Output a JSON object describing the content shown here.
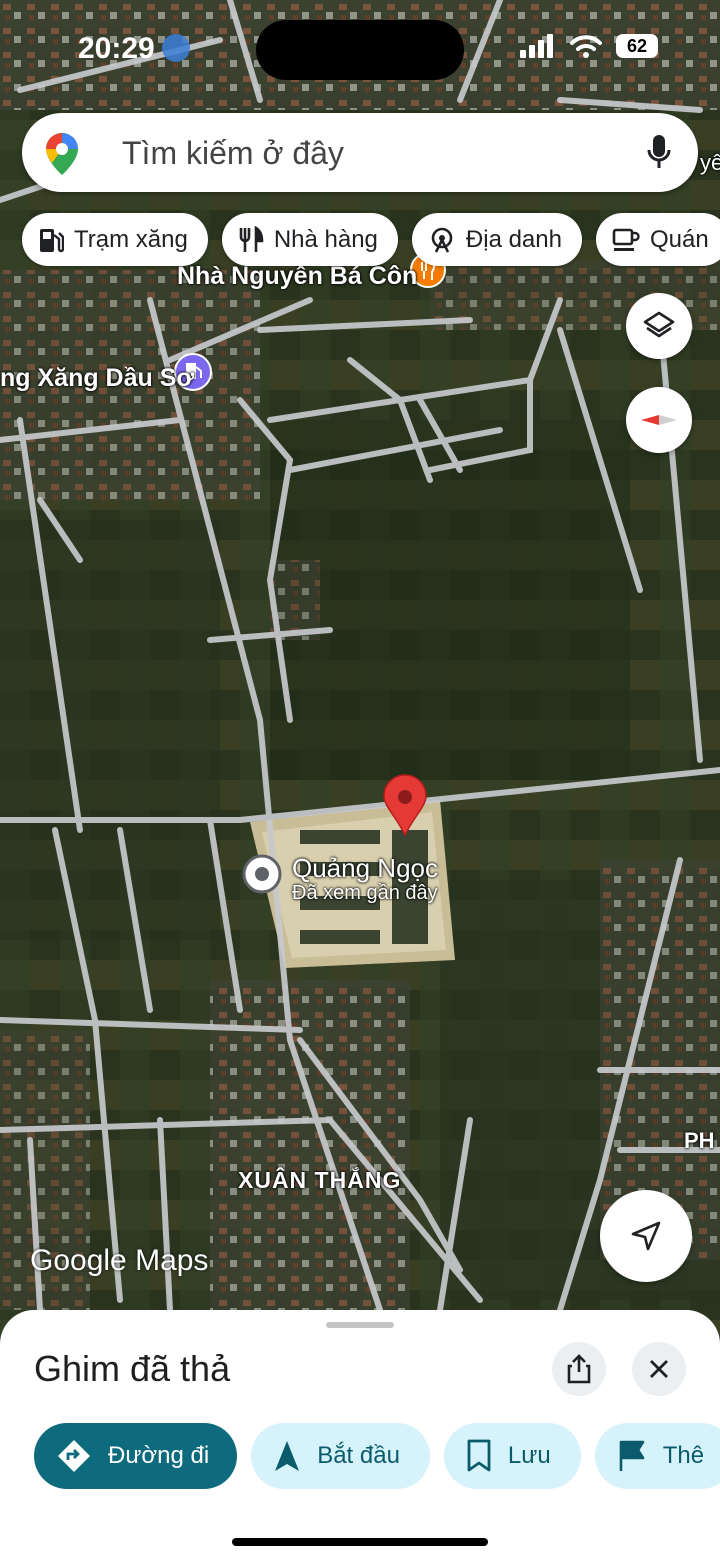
{
  "status_bar": {
    "time": "20:29",
    "battery": "62"
  },
  "search": {
    "placeholder": "Tìm kiếm ở đây"
  },
  "chips": [
    {
      "label": "Trạm xăng",
      "icon": "gas-station-icon"
    },
    {
      "label": "Nhà hàng",
      "icon": "restaurant-icon"
    },
    {
      "label": "Địa danh",
      "icon": "landmark-icon"
    },
    {
      "label": "Quán",
      "icon": "cafe-icon"
    }
  ],
  "map": {
    "labels": {
      "restaurant": "Nhà Nguyễn Bá Côn",
      "gas_station": "ng Xăng Dầu Sơ",
      "place_name": "Quảng Ngọc",
      "place_sub": "Đã xem gần đây",
      "area": "XUÂN THẮNG",
      "edge_right": "PH",
      "edge_top_right": "yê"
    },
    "attribution": "Google Maps",
    "colors": {
      "pin": "#e53935",
      "poi_restaurant": "#f57c00",
      "poi_gas": "#7b68ee",
      "compass_red": "#e53935"
    }
  },
  "sheet": {
    "title": "Ghim đã thả",
    "actions": [
      {
        "label": "Đường đi",
        "icon": "directions-icon",
        "primary": true
      },
      {
        "label": "Bắt đầu",
        "icon": "navigation-arrow-icon"
      },
      {
        "label": "Lưu",
        "icon": "bookmark-icon"
      },
      {
        "label": "Thê",
        "icon": "flag-icon"
      }
    ],
    "colors": {
      "primary": "#0e6b7e",
      "secondary_bg": "#d6f2fb"
    }
  }
}
